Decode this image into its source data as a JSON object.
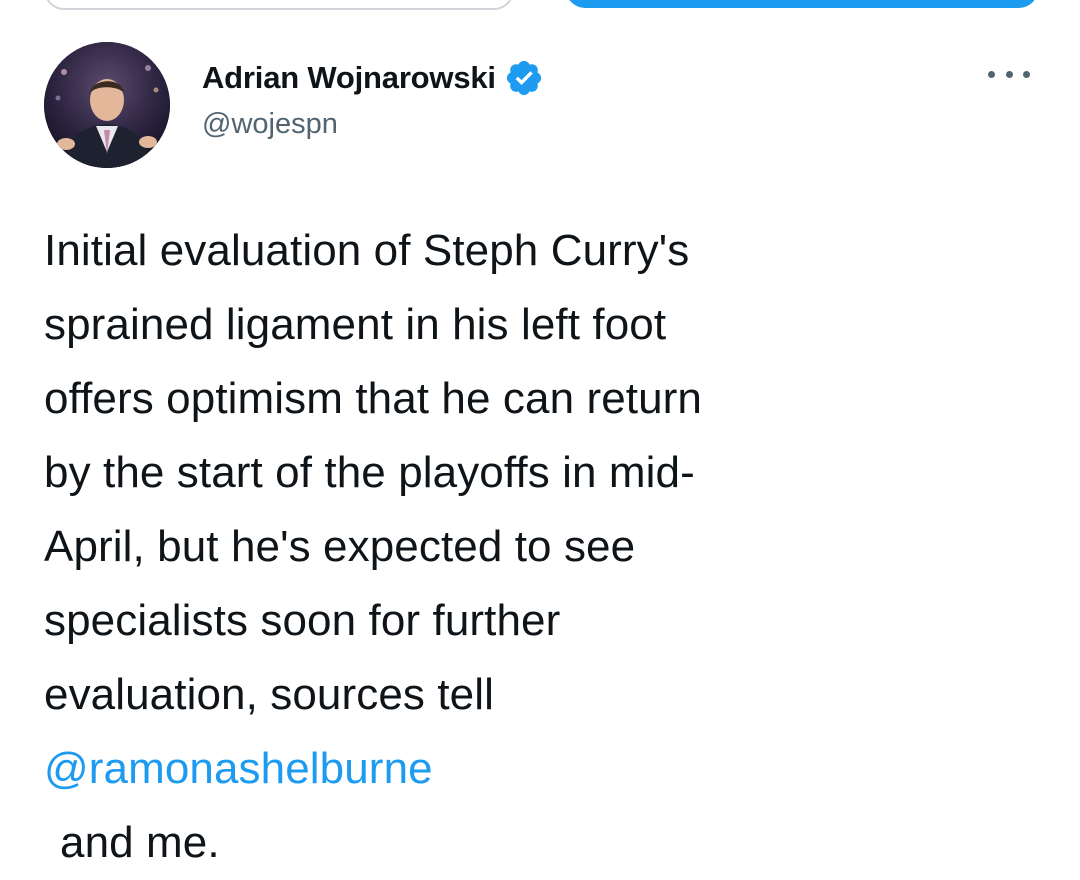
{
  "colors": {
    "accent": "#1d9bf0",
    "text": "#0f1419",
    "secondary": "#536471"
  },
  "tweet": {
    "author": {
      "display_name": "Adrian Wojnarowski",
      "handle": "@wojespn",
      "verified_icon": "verified-badge-icon",
      "avatar_icon": "avatar"
    },
    "more_icon": "more-options-icon",
    "lines": [
      "Initial evaluation of Steph Curry's",
      "sprained ligament in his left foot",
      "offers optimism that he can return",
      "by the start of the playoffs in mid-",
      "April, but he's expected to see",
      "specialists soon for further",
      "evaluation, sources tell"
    ],
    "mention": "@ramonashelburne",
    "tail": "and me."
  }
}
